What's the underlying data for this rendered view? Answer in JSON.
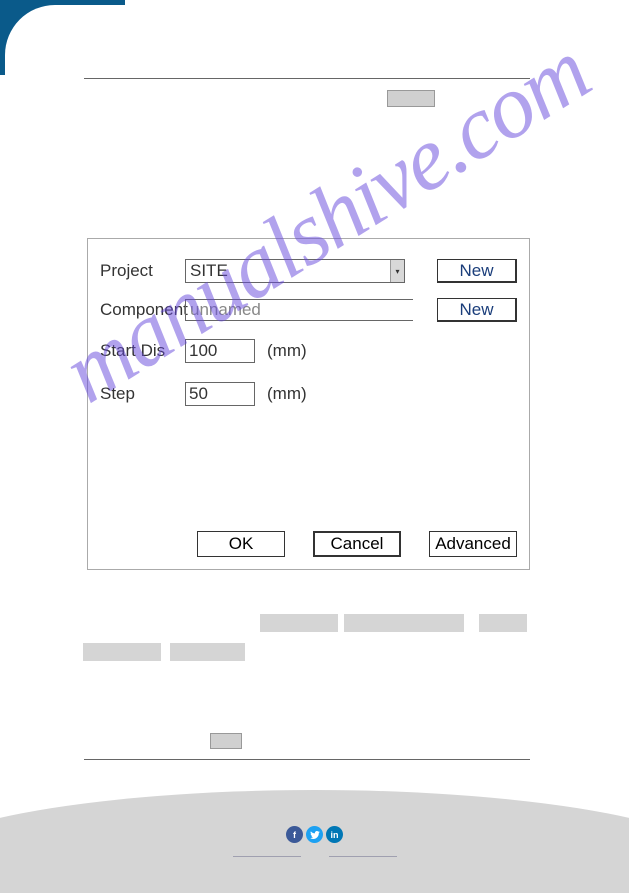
{
  "dialog": {
    "project": {
      "label": "Project",
      "value": "SITE",
      "new_btn": "New"
    },
    "component": {
      "label": "Component",
      "value": "unnamed",
      "new_btn": "New"
    },
    "start_dis": {
      "label": "Start Dis",
      "value": "100",
      "unit": "(mm)"
    },
    "step": {
      "label": "Step",
      "value": "50",
      "unit": "(mm)"
    },
    "buttons": {
      "ok": "OK",
      "cancel": "Cancel",
      "advanced": "Advanced"
    }
  },
  "watermark": "manualshive.com",
  "social": {
    "fb": "f",
    "tw": "",
    "li": "in"
  }
}
